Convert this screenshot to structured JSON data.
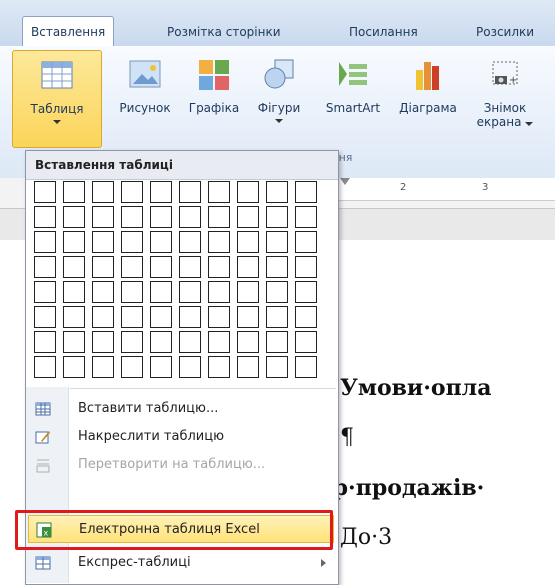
{
  "tabs": [
    {
      "label": "Вставлення",
      "active": true
    },
    {
      "label": "Розмітка сторінки",
      "active": false
    },
    {
      "label": "Посилання",
      "active": false
    },
    {
      "label": "Розсилки",
      "active": false
    }
  ],
  "ribbon": {
    "buttons": [
      {
        "label": "Таблиця",
        "label2": "",
        "icon": "table-icon",
        "active": true
      },
      {
        "label": "Рисунок",
        "label2": "",
        "icon": "picture-icon"
      },
      {
        "label": "Графіка",
        "label2": "",
        "icon": "clipart-icon"
      },
      {
        "label": "Фігури",
        "label2": "",
        "icon": "shapes-icon"
      },
      {
        "label": "SmartArt",
        "label2": "",
        "icon": "smartart-icon"
      },
      {
        "label": "Діаграма",
        "label2": "",
        "icon": "chart-icon"
      },
      {
        "label": "Знімок",
        "label2": "екрана",
        "icon": "screenshot-icon"
      }
    ],
    "group_label_partial": "кення"
  },
  "ruler": {
    "marks": [
      "2",
      "3"
    ]
  },
  "dropdown": {
    "header": "Вставлення таблиці",
    "grid": {
      "cols": 10,
      "rows": 8
    },
    "items": [
      {
        "label": "Вставити таблицю...",
        "icon": "insert-table-icon",
        "disabled": false,
        "highlighted": false,
        "submenu": false
      },
      {
        "label": "Накреслити таблицю",
        "icon": "draw-table-icon",
        "disabled": false,
        "highlighted": false,
        "submenu": false
      },
      {
        "label": "Перетворити на таблицю...",
        "icon": "convert-table-icon",
        "disabled": true,
        "highlighted": false,
        "submenu": false
      },
      {
        "label": "Електронна таблиця Excel",
        "icon": "excel-spreadsheet-icon",
        "disabled": false,
        "highlighted": true,
        "submenu": false
      },
      {
        "label": "Експрес-таблиці",
        "icon": "quick-tables-icon",
        "disabled": false,
        "highlighted": false,
        "submenu": true
      }
    ]
  },
  "document": {
    "lines": [
      "Умови·опла",
      "¶",
      "ор·продажів·",
      "До·3"
    ]
  }
}
